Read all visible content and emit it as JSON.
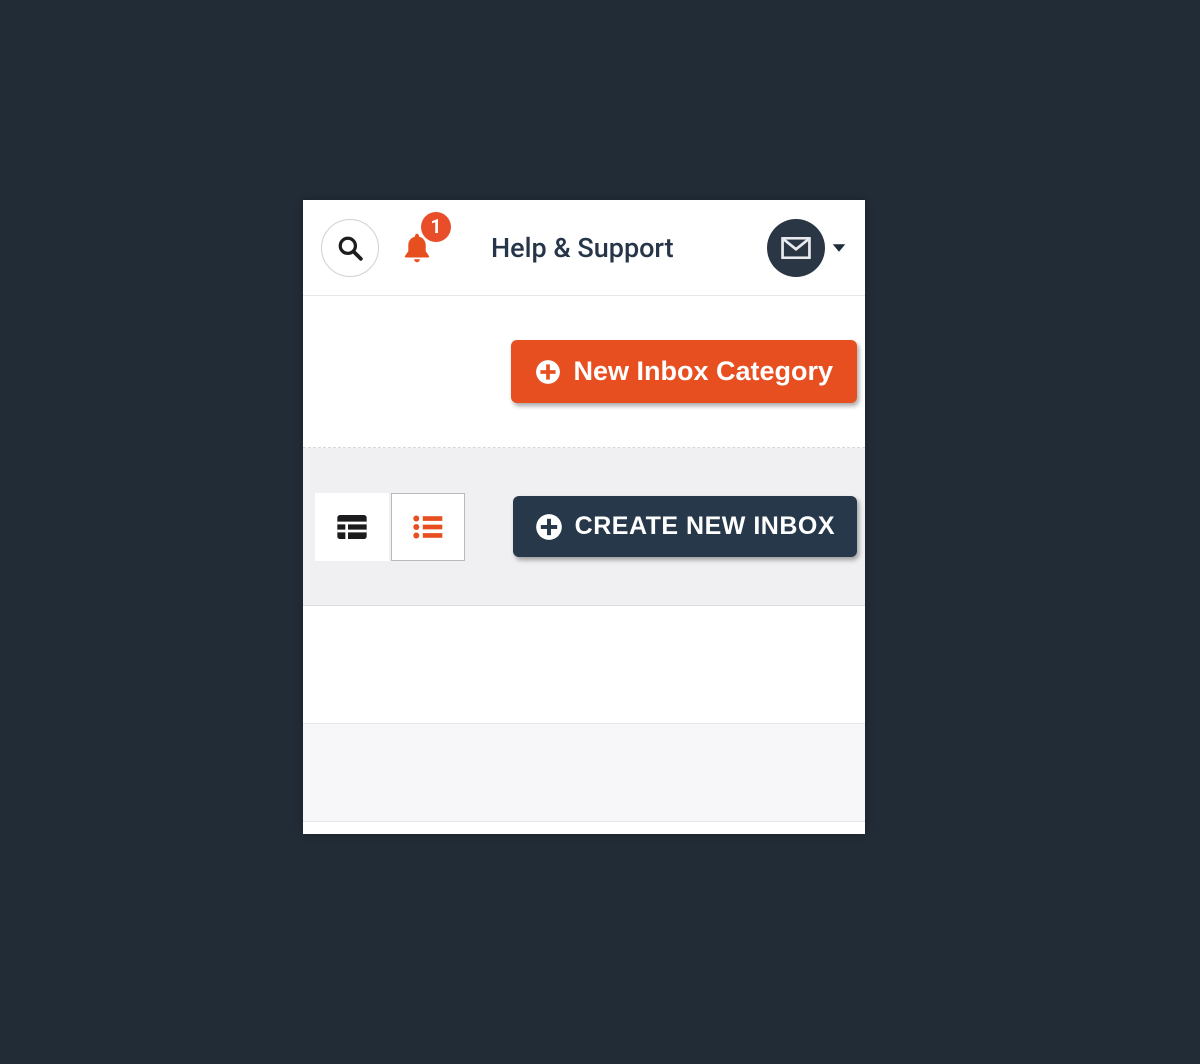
{
  "topbar": {
    "help_label": "Help & Support",
    "notification_count": "1"
  },
  "buttons": {
    "new_category_label": "New Inbox Category",
    "create_inbox_label": "CREATE NEW INBOX"
  },
  "colors": {
    "accent_orange": "#e74e20",
    "accent_dark": "#26384a",
    "bg_dark": "#222c37"
  }
}
